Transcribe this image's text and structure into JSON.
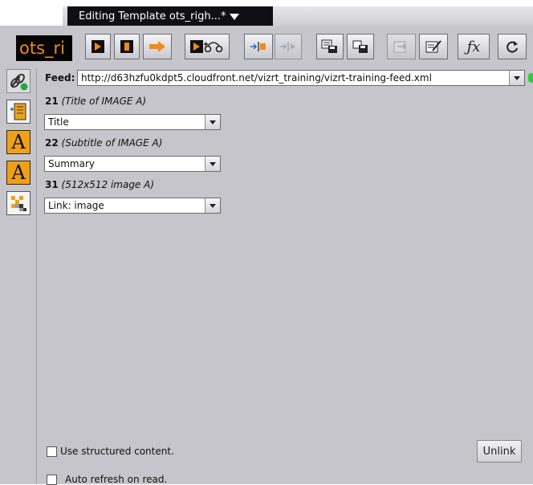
{
  "window": {
    "title_tab": "Editing Template ots_righ...*"
  },
  "toolbar": {
    "template_name": "ots_ri"
  },
  "feed": {
    "label": "Feed:",
    "url": "http://d63hzfu0kdpt5.cloudfront.net/vizrt_training/vizrt-training-feed.xml",
    "status_color": "#2ecc40"
  },
  "fields": [
    {
      "number": "21",
      "desc": "(Title of IMAGE A)",
      "value": "Title"
    },
    {
      "number": "22",
      "desc": "(Subtitle of IMAGE A)",
      "value": "Summary"
    },
    {
      "number": "31",
      "desc": "(512x512 image A)",
      "value": "Link: image"
    }
  ],
  "options": {
    "structured_label": "Use structured content.",
    "structured_checked": false,
    "autorefresh_label": "Auto refresh on read.",
    "autorefresh_checked": false
  },
  "buttons": {
    "unlink": "Unlink"
  },
  "colors": {
    "accent": "#f08a1c",
    "panel": "#c5c5cb"
  }
}
